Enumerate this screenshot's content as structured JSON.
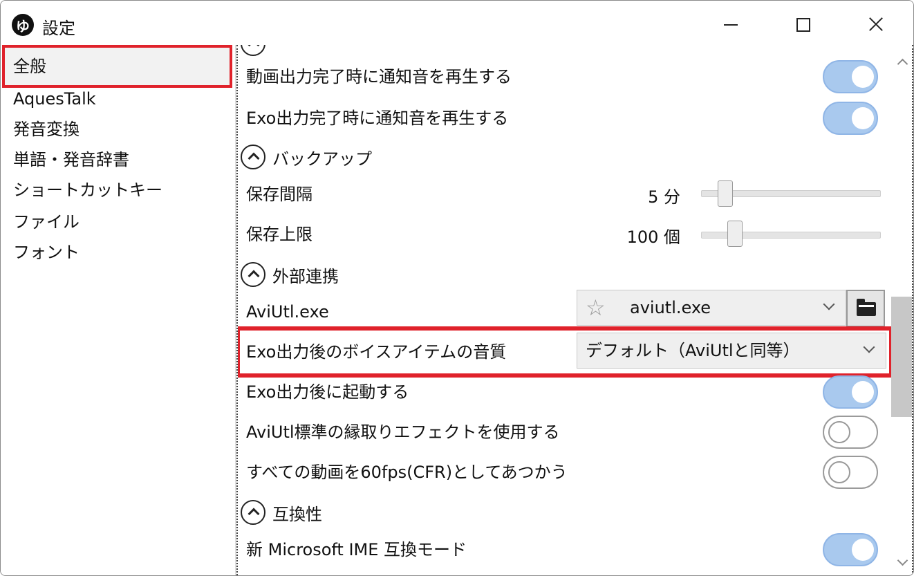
{
  "window": {
    "title": "設定",
    "logo_glyph": "ゆ"
  },
  "sidebar": {
    "items": [
      {
        "label": "全般",
        "selected": true
      },
      {
        "label": "AquesTalk"
      },
      {
        "label": "発音変換"
      },
      {
        "label": "単語・発音辞書"
      },
      {
        "label": "ショートカットキー"
      },
      {
        "label": "ファイル"
      },
      {
        "label": "フォント"
      }
    ]
  },
  "content": {
    "notify_video": {
      "label": "動画出力完了時に通知音を再生する",
      "on": true
    },
    "notify_exo": {
      "label": "Exo出力完了時に通知音を再生する",
      "on": true
    },
    "backup_section": "バックアップ",
    "save_interval": {
      "label": "保存間隔",
      "value": "5 分"
    },
    "save_limit": {
      "label": "保存上限",
      "value": "100 個"
    },
    "external_section": "外部連携",
    "aviutl_exe": {
      "label": "AviUtl.exe",
      "value": "aviutl.exe"
    },
    "voice_quality": {
      "label": "Exo出力後のボイスアイテムの音質",
      "value": "デフォルト（AviUtlと同等）"
    },
    "launch_after": {
      "label": "Exo出力後に起動する",
      "on": true
    },
    "aviutl_border": {
      "label": "AviUtl標準の縁取りエフェクトを使用する",
      "on": false
    },
    "fps60": {
      "label": "すべての動画を60fps(CFR)としてあつかう",
      "on": false
    },
    "compat_section": "互換性",
    "ime_mode": {
      "label": "新 Microsoft IME 互換モード",
      "on": true
    }
  },
  "colors": {
    "highlight": "#e0222b",
    "toggle_on": "#a9c9ee"
  }
}
